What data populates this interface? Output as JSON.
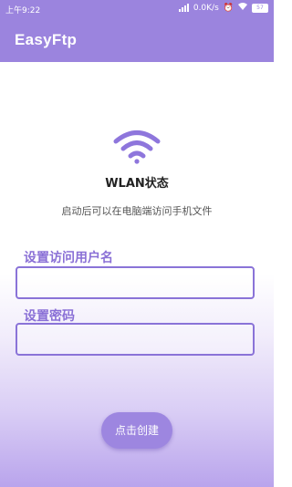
{
  "status_bar": {
    "time": "上午9:22",
    "net_speed": "0.0K/s",
    "battery": "57"
  },
  "app": {
    "title": "EasyFtp"
  },
  "main": {
    "wifi_icon": "wifi-icon",
    "wlan_title": "WLAN状态",
    "subtitle": "启动后可以在电脑端访问手机文件",
    "username_label": "设置访问用户名",
    "username_value": "",
    "password_label": "设置密码",
    "password_value": "",
    "create_button": "点击创建"
  },
  "colors": {
    "accent": "#9b84de",
    "label": "#8a70d6",
    "border": "#8a73d8"
  }
}
